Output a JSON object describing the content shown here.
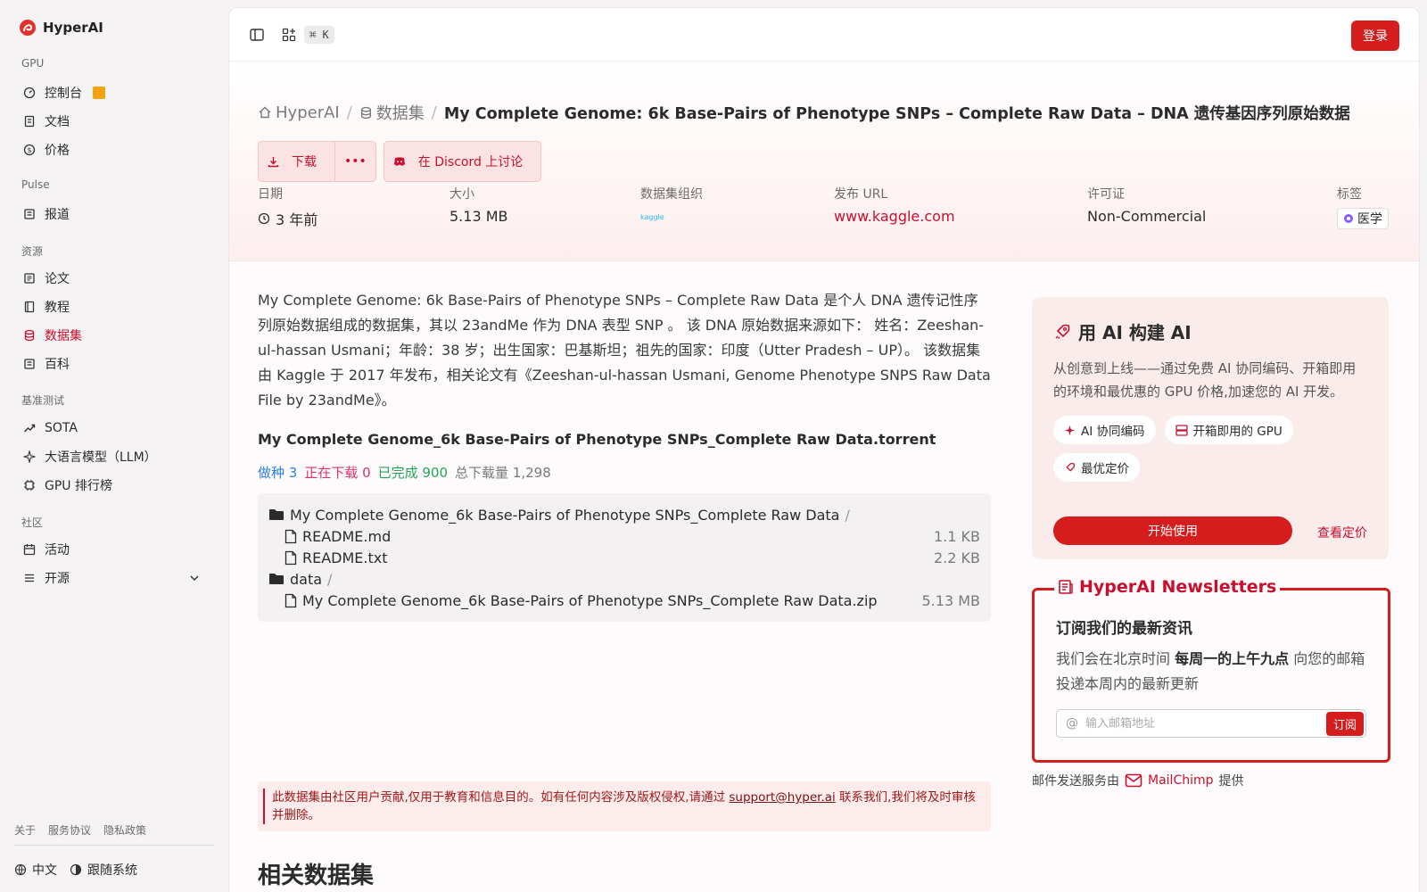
{
  "brand": "HyperAI",
  "sidebar": {
    "sections": [
      {
        "label": "GPU",
        "items": [
          {
            "label": "控制台"
          },
          {
            "label": "文档"
          },
          {
            "label": "价格"
          }
        ]
      },
      {
        "label": "Pulse",
        "items": [
          {
            "label": "报道"
          }
        ]
      },
      {
        "label": "资源",
        "items": [
          {
            "label": "论文"
          },
          {
            "label": "教程"
          },
          {
            "label": "数据集"
          },
          {
            "label": "百科"
          }
        ]
      },
      {
        "label": "基准测试",
        "items": [
          {
            "label": "SOTA"
          },
          {
            "label": "大语言模型（LLM）"
          },
          {
            "label": "GPU 排行榜"
          }
        ]
      },
      {
        "label": "社区",
        "items": [
          {
            "label": "活动"
          },
          {
            "label": "开源"
          }
        ]
      }
    ],
    "footer_links": [
      "关于",
      "服务协议",
      "隐私政策"
    ],
    "language": "中文",
    "theme": "跟随系统"
  },
  "topbar": {
    "shortcut": "⌘ K",
    "login": "登录"
  },
  "breadcrumb": {
    "home": "HyperAI",
    "datasets": "数据集",
    "title": "My Complete Genome: 6k Base-Pairs of Phenotype SNPs – Complete Raw Data – DNA 遗传基因序列原始数据"
  },
  "actions": {
    "download": "下载",
    "more": "•••",
    "discord": "在 Discord 上讨论"
  },
  "meta": {
    "date": {
      "label": "日期",
      "value": "3 年前"
    },
    "size": {
      "label": "大小",
      "value": "5.13 MB"
    },
    "org": {
      "label": "数据集组织",
      "value": "kaggle"
    },
    "url": {
      "label": "发布 URL",
      "value": "www.kaggle.com"
    },
    "license": {
      "label": "许可证",
      "value": "Non-Commercial"
    },
    "tags": {
      "label": "标签",
      "value": "医学"
    }
  },
  "description": "My Complete Genome: 6k Base-Pairs of Phenotype SNPs – Complete Raw Data 是个人 DNA 遗传记性序列原始数据组成的数据集，其以 23andMe 作为 DNA 表型 SNP 。 该 DNA 原始数据来源如下： 姓名：Zeeshan-ul-hassan Usmani；年龄：38 岁；出生国家：巴基斯坦；祖先的国家：印度（Utter Pradesh – UP）。 该数据集由 Kaggle 于 2017 年发布，相关论文有《Zeeshan-ul-hassan Usmani, Genome Phenotype SNPS Raw Data File by 23andMe》。",
  "torrent": {
    "title": "My Complete Genome_6k Base-Pairs of Phenotype SNPs_Complete Raw Data.torrent",
    "seeding": "做种 3",
    "downloading": "正在下载 0",
    "completed": "已完成 900",
    "total": "总下载量 1,298",
    "colors": {
      "seeding": "#2d7fe0",
      "downloading": "#e0316a",
      "completed": "#22a559",
      "total": "#7a7a7a"
    },
    "files": [
      {
        "name": "My Complete Genome_6k Base-Pairs of Phenotype SNPs_Complete Raw Data",
        "type": "folder",
        "level": 0,
        "size": ""
      },
      {
        "name": "README.md",
        "type": "file",
        "level": 1,
        "size": "1.1 KB"
      },
      {
        "name": "README.txt",
        "type": "file",
        "level": 1,
        "size": "2.2 KB"
      },
      {
        "name": "data",
        "type": "folder",
        "level": 0,
        "size": ""
      },
      {
        "name": "My Complete Genome_6k Base-Pairs of Phenotype SNPs_Complete Raw Data.zip",
        "type": "file",
        "level": 1,
        "size": "5.13 MB"
      }
    ]
  },
  "notice": {
    "before": "此数据集由社区用户贡献,仅用于教育和信息目的。如有任何内容涉及版权侵权,请通过 ",
    "email": "support@hyper.ai",
    "after": " 联系我们,我们将及时审核并删除。"
  },
  "related_title": "相关数据集",
  "ai_card": {
    "title": "用 AI 构建 AI",
    "text": "从创意到上线——通过免费 AI 协同编码、开箱即用的环境和最优惠的 GPU 价格,加速您的 AI 开发。",
    "chips": [
      "AI 协同编码",
      "开箱即用的 GPU",
      "最优定价"
    ],
    "start": "开始使用",
    "pricing": "查看定价"
  },
  "newsletter": {
    "title": "HyperAI Newsletters",
    "heading": "订阅我们的最新资讯",
    "text_before": "我们会在北京时间 ",
    "text_bold": "每周一的上午九点",
    "text_after": " 向您的邮箱投递本周内的最新更新",
    "placeholder": "输入邮箱地址",
    "subscribe": "订阅",
    "powered_before": "邮件发送服务由",
    "powered_brand": "MailChimp",
    "powered_after": "提供"
  },
  "colors": {
    "accent": "#d51d1d",
    "accent_text": "#c8102e"
  }
}
